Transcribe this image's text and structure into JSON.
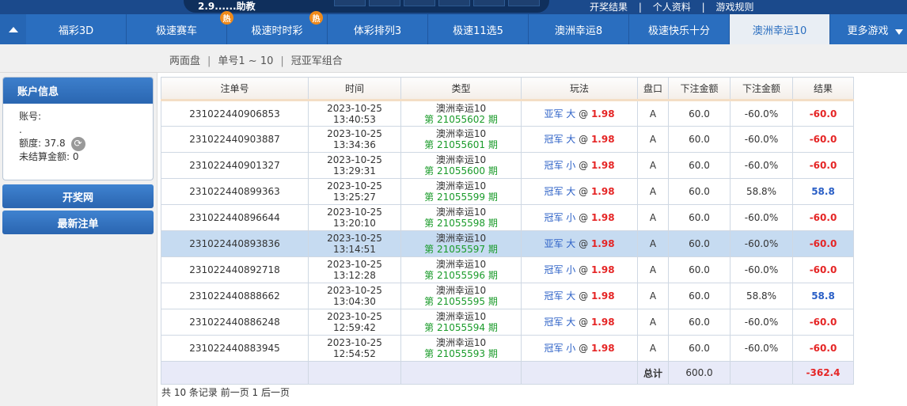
{
  "topbar": {
    "partial_text": "2.9......助教",
    "links": [
      "开奖结果",
      "|",
      "个人资料",
      "|",
      "游戏规则"
    ]
  },
  "nav": {
    "items": [
      {
        "label": "福彩3D",
        "hot": false,
        "active": false
      },
      {
        "label": "极速赛车",
        "hot": true,
        "active": false
      },
      {
        "label": "极速时时彩",
        "hot": true,
        "active": false
      },
      {
        "label": "体彩排列3",
        "hot": false,
        "active": false
      },
      {
        "label": "极速11选5",
        "hot": false,
        "active": false
      },
      {
        "label": "澳洲幸运8",
        "hot": false,
        "active": false
      },
      {
        "label": "极速快乐十分",
        "hot": false,
        "active": false
      },
      {
        "label": "澳洲幸运10",
        "hot": false,
        "active": true
      }
    ],
    "hot_badge": "热",
    "more_label": "更多游戏"
  },
  "subnav": {
    "items": [
      "两面盘",
      "单号1 ~ 10",
      "冠亚军组合"
    ],
    "separator": "|"
  },
  "account": {
    "title": "账户信息",
    "account_label": "账号:",
    "account_value": ".",
    "credit_label": "额度: 37.8",
    "unsettled_label": "未结算金额: 0"
  },
  "sidebar_buttons": {
    "draw_site": "开奖网",
    "latest_bets": "最新注单"
  },
  "table": {
    "headers": [
      "注单号",
      "时间",
      "类型",
      "玩法",
      "盘口",
      "下注金额",
      "下注金额",
      "结果"
    ],
    "rows": [
      {
        "id": "231022440906853",
        "date": "2023-10-25",
        "time": "13:40:53",
        "game": "澳洲幸运10",
        "issue": "第 21055602 期",
        "play": "亚军 大",
        "at": "@",
        "odds": "1.98",
        "pan": "A",
        "amount": "60.0",
        "rate": "-60.0%",
        "result": "-60.0",
        "result_type": "neg",
        "highlight": false
      },
      {
        "id": "231022440903887",
        "date": "2023-10-25",
        "time": "13:34:36",
        "game": "澳洲幸运10",
        "issue": "第 21055601 期",
        "play": "冠军 大",
        "at": "@",
        "odds": "1.98",
        "pan": "A",
        "amount": "60.0",
        "rate": "-60.0%",
        "result": "-60.0",
        "result_type": "neg",
        "highlight": false
      },
      {
        "id": "231022440901327",
        "date": "2023-10-25",
        "time": "13:29:31",
        "game": "澳洲幸运10",
        "issue": "第 21055600 期",
        "play": "冠军 小",
        "at": "@",
        "odds": "1.98",
        "pan": "A",
        "amount": "60.0",
        "rate": "-60.0%",
        "result": "-60.0",
        "result_type": "neg",
        "highlight": false
      },
      {
        "id": "231022440899363",
        "date": "2023-10-25",
        "time": "13:25:27",
        "game": "澳洲幸运10",
        "issue": "第 21055599 期",
        "play": "冠军 大",
        "at": "@",
        "odds": "1.98",
        "pan": "A",
        "amount": "60.0",
        "rate": "58.8%",
        "result": "58.8",
        "result_type": "pos",
        "highlight": false
      },
      {
        "id": "231022440896644",
        "date": "2023-10-25",
        "time": "13:20:10",
        "game": "澳洲幸运10",
        "issue": "第 21055598 期",
        "play": "冠军 小",
        "at": "@",
        "odds": "1.98",
        "pan": "A",
        "amount": "60.0",
        "rate": "-60.0%",
        "result": "-60.0",
        "result_type": "neg",
        "highlight": false
      },
      {
        "id": "231022440893836",
        "date": "2023-10-25",
        "time": "13:14:51",
        "game": "澳洲幸运10",
        "issue": "第 21055597 期",
        "play": "亚军 大",
        "at": "@",
        "odds": "1.98",
        "pan": "A",
        "amount": "60.0",
        "rate": "-60.0%",
        "result": "-60.0",
        "result_type": "neg",
        "highlight": true
      },
      {
        "id": "231022440892718",
        "date": "2023-10-25",
        "time": "13:12:28",
        "game": "澳洲幸运10",
        "issue": "第 21055596 期",
        "play": "冠军 小",
        "at": "@",
        "odds": "1.98",
        "pan": "A",
        "amount": "60.0",
        "rate": "-60.0%",
        "result": "-60.0",
        "result_type": "neg",
        "highlight": false
      },
      {
        "id": "231022440888662",
        "date": "2023-10-25",
        "time": "13:04:30",
        "game": "澳洲幸运10",
        "issue": "第 21055595 期",
        "play": "冠军 大",
        "at": "@",
        "odds": "1.98",
        "pan": "A",
        "amount": "60.0",
        "rate": "58.8%",
        "result": "58.8",
        "result_type": "pos",
        "highlight": false
      },
      {
        "id": "231022440886248",
        "date": "2023-10-25",
        "time": "12:59:42",
        "game": "澳洲幸运10",
        "issue": "第 21055594 期",
        "play": "冠军 大",
        "at": "@",
        "odds": "1.98",
        "pan": "A",
        "amount": "60.0",
        "rate": "-60.0%",
        "result": "-60.0",
        "result_type": "neg",
        "highlight": false
      },
      {
        "id": "231022440883945",
        "date": "2023-10-25",
        "time": "12:54:52",
        "game": "澳洲幸运10",
        "issue": "第 21055593 期",
        "play": "冠军 小",
        "at": "@",
        "odds": "1.98",
        "pan": "A",
        "amount": "60.0",
        "rate": "-60.0%",
        "result": "-60.0",
        "result_type": "neg",
        "highlight": false
      }
    ],
    "total_label": "总计",
    "total_amount": "600.0",
    "total_result": "-362.4"
  },
  "pagination": "共 10 条记录 前一页 1 后一页",
  "colors": {
    "nav_blue": "#2a6ebf",
    "issue_green": "#1a9b2a",
    "loss_red": "#e52525",
    "win_blue": "#2a5fc6",
    "highlight_row": "#c6dbf1"
  }
}
